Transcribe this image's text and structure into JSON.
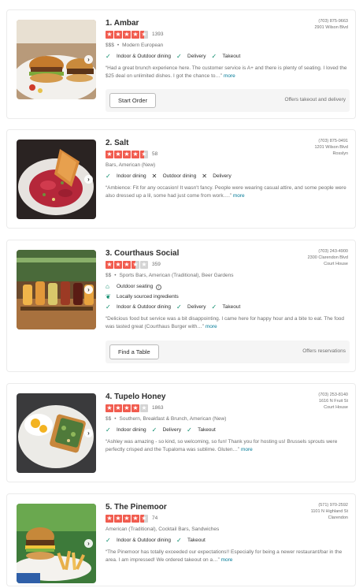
{
  "results": [
    {
      "title": "1. Ambar",
      "rating": 4.5,
      "review_count": "1393",
      "price": "$$$",
      "categories": "Modern European",
      "phone": "(703) 875-9663",
      "address_lines": [
        "2901 Wilson Blvd"
      ],
      "amenities": [
        {
          "label": "Indoor & Outdoor dining",
          "available": true
        },
        {
          "label": "Delivery",
          "available": true
        },
        {
          "label": "Takeout",
          "available": true
        }
      ],
      "features": [],
      "snippet": "“Had a great brunch experience here. The customer service is A+ and there is plenty of seating. I loved the $25 deal on unlimited dishes. I got the chance to…”",
      "more_label": "more",
      "action": {
        "button": "Start Order",
        "note": "Offers takeout and delivery"
      }
    },
    {
      "title": "2. Salt",
      "rating": 4.5,
      "review_count": "58",
      "price": "",
      "categories": "Bars, American (New)",
      "phone": "(703) 875-0491",
      "address_lines": [
        "1201 Wilson Blvd",
        "Rosslyn"
      ],
      "amenities": [
        {
          "label": "Indoor dining",
          "available": true
        },
        {
          "label": "Outdoor dining",
          "available": false
        },
        {
          "label": "Delivery",
          "available": false
        }
      ],
      "features": [],
      "snippet": "“Ambience: Fit for any occasion! It wasn't fancy. People were wearing casual attire, and some people were also dressed up a lil, some had just come from work….”",
      "more_label": "more",
      "action": null
    },
    {
      "title": "3. Courthaus Social",
      "rating": 3.5,
      "review_count": "359",
      "price": "$$",
      "categories": "Sports Bars, American (Traditional), Beer Gardens",
      "phone": "(703) 243-4900",
      "address_lines": [
        "2300 Clarendon Blvd",
        "Court House"
      ],
      "features": [
        {
          "label": "Outdoor seating",
          "icon": "storefront-icon",
          "info": true
        },
        {
          "label": "Locally sourced ingredients",
          "icon": "leaf-icon",
          "info": false
        }
      ],
      "amenities": [
        {
          "label": "Indoor & Outdoor dining",
          "available": true
        },
        {
          "label": "Delivery",
          "available": true
        },
        {
          "label": "Takeout",
          "available": true
        }
      ],
      "snippet": "“Delicious food but service was a bit disappointing. I came here for happy hour and a bite to eat. The food was tasted great (Courthaus Burger with…”",
      "more_label": "more",
      "action": {
        "button": "Find a Table",
        "note": "Offers reservations"
      }
    },
    {
      "title": "4. Tupelo Honey",
      "rating": 4,
      "review_count": "1863",
      "price": "$$",
      "categories": "Southern, Breakfast & Brunch, American (New)",
      "phone": "(703) 253-8140",
      "address_lines": [
        "1616 N Fruit St",
        "Court House"
      ],
      "amenities": [
        {
          "label": "Indoor dining",
          "available": true
        },
        {
          "label": "Delivery",
          "available": true
        },
        {
          "label": "Takeout",
          "available": true
        }
      ],
      "features": [],
      "snippet": "“Ashley was amazing - so kind, so welcoming, so fun! Thank you for hosting us! Brussels sprouts were perfectly crisped and the Tupaloma was sublime. Gluten…”",
      "more_label": "more",
      "action": null
    },
    {
      "title": "5. The Pinemoor",
      "rating": 4.5,
      "review_count": "74",
      "price": "",
      "categories": "American (Traditional), Cocktail Bars, Sandwiches",
      "phone": "(571) 970-2592",
      "address_lines": [
        "1101 N Highland St",
        "Clarendon"
      ],
      "amenities": [
        {
          "label": "Indoor & Outdoor dining",
          "available": true
        },
        {
          "label": "Takeout",
          "available": true
        }
      ],
      "features": [],
      "snippet": "“The Pinemoor has totally exceeded our expectations!! Especially for being a newer restaurant/bar in the area. I am impressed! We ordered takeout on a…”",
      "more_label": "more",
      "action": null
    }
  ],
  "colors": {
    "star": "#f15c4f",
    "check": "#088a6a",
    "link": "#027a97"
  },
  "icons": {
    "check": "check-icon",
    "cross": "x-icon",
    "photo_next": "chevron-right-icon"
  }
}
